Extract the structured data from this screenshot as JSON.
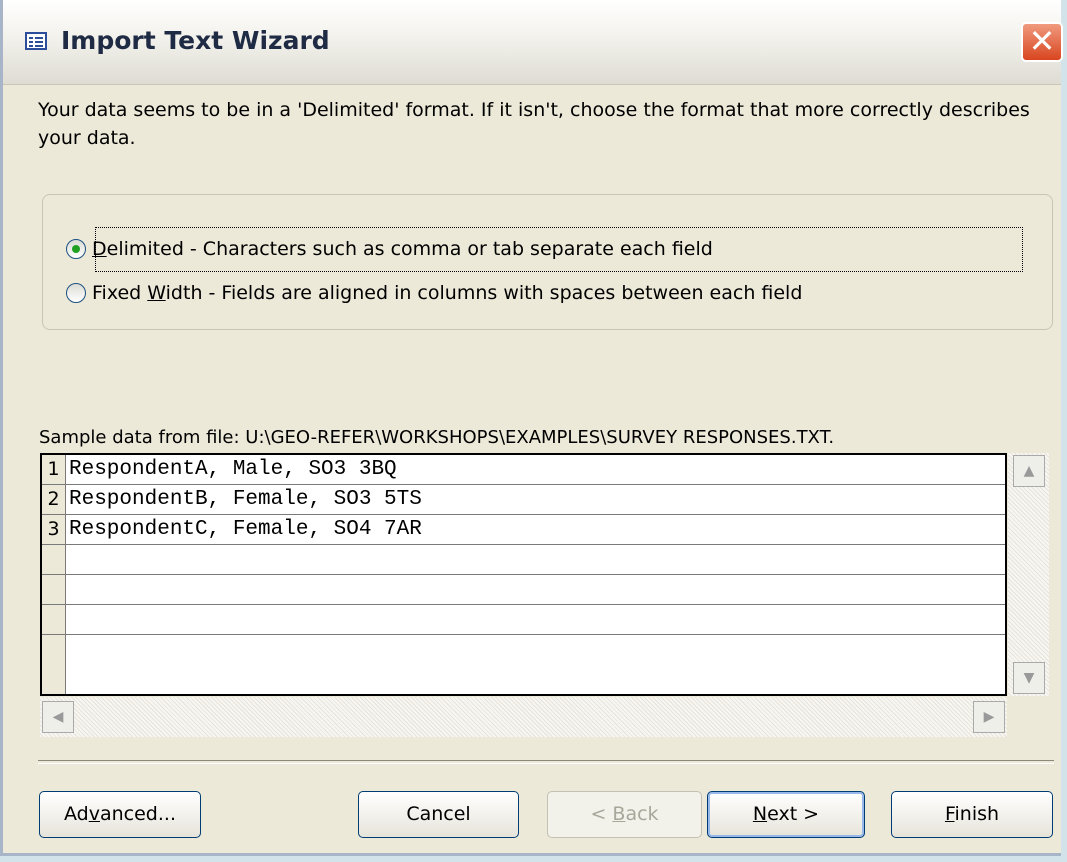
{
  "window": {
    "title": "Import Text Wizard",
    "close_glyph": "✕"
  },
  "intro": "Your data seems to be in a 'Delimited' format. If it isn't, choose the format that more correctly describes your data.",
  "format_options": [
    {
      "accel": "D",
      "rest": "elimited - Characters such as comma or tab separate each field",
      "checked": true
    },
    {
      "pre": "Fixed ",
      "accel": "W",
      "rest": "idth - Fields are aligned in columns with spaces between each field",
      "checked": false
    }
  ],
  "sample": {
    "label": "Sample data from file: U:\\GEO-REFER\\WORKSHOPS\\EXAMPLES\\SURVEY RESPONSES.TXT.",
    "rows": [
      {
        "num": "1",
        "text": "RespondentA, Male, SO3 3BQ"
      },
      {
        "num": "2",
        "text": "RespondentB, Female, SO3 5TS"
      },
      {
        "num": "3",
        "text": "RespondentC, Female, SO4 7AR"
      },
      {
        "num": "",
        "text": ""
      },
      {
        "num": "",
        "text": ""
      },
      {
        "num": "",
        "text": ""
      },
      {
        "num": "",
        "text": ""
      }
    ]
  },
  "buttons": {
    "advanced": {
      "pre": "Ad",
      "accel": "v",
      "rest": "anced..."
    },
    "cancel": "Cancel",
    "back": {
      "pre": "< ",
      "accel": "B",
      "rest": "ack",
      "enabled": false
    },
    "next": {
      "accel": "N",
      "rest": "ext >"
    },
    "finish": {
      "accel": "F",
      "rest": "inish"
    }
  },
  "colors": {
    "dialog_bg": "#ece9d8",
    "close_red": "#d8451f",
    "radio_dot": "#21a121",
    "border_blue": "#003c74"
  }
}
